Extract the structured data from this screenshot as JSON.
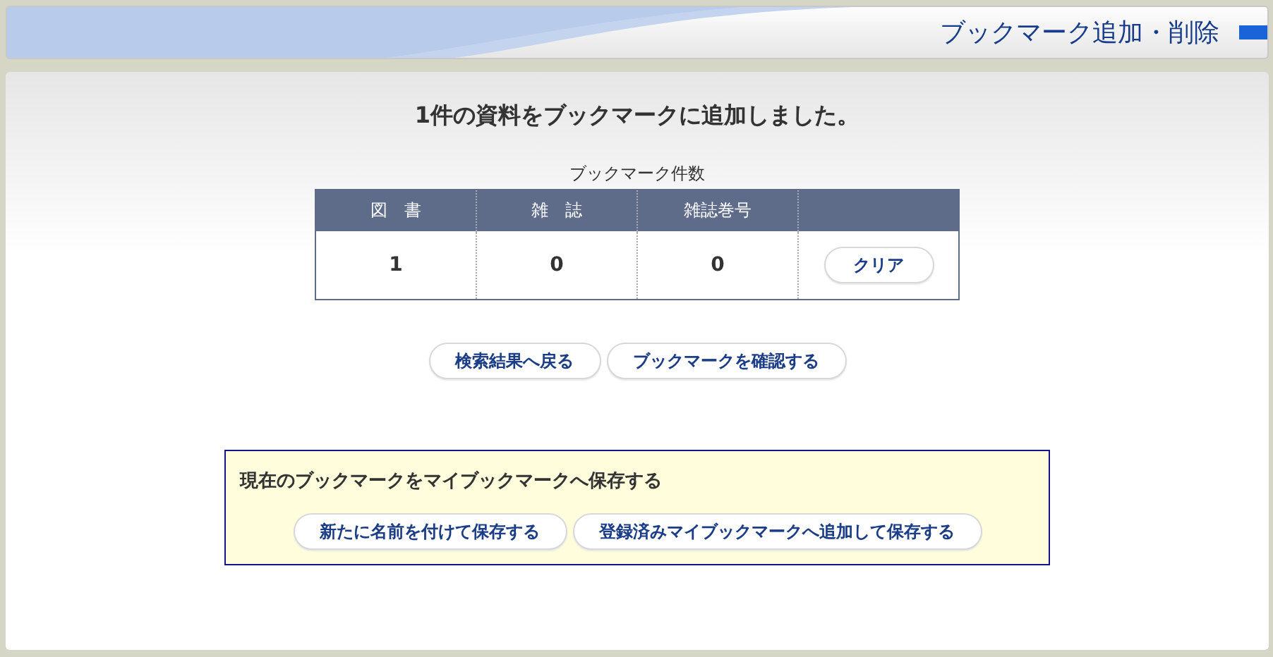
{
  "header": {
    "title": "ブックマーク追加・削除"
  },
  "message": "1件の資料をブックマークに追加しました。",
  "counts": {
    "caption": "ブックマーク件数",
    "columns": [
      "図　書",
      "雑　誌",
      "雑誌巻号"
    ],
    "values": [
      "1",
      "0",
      "0"
    ],
    "clear_button": "クリア"
  },
  "actions": [
    "検索結果へ戻る",
    "ブックマークを確認する"
  ],
  "save_box": {
    "title": "現在のブックマークをマイブックマークへ保存する",
    "buttons": [
      "新たに名前を付けて保存する",
      "登録済みマイブックマークへ追加して保存する"
    ]
  }
}
